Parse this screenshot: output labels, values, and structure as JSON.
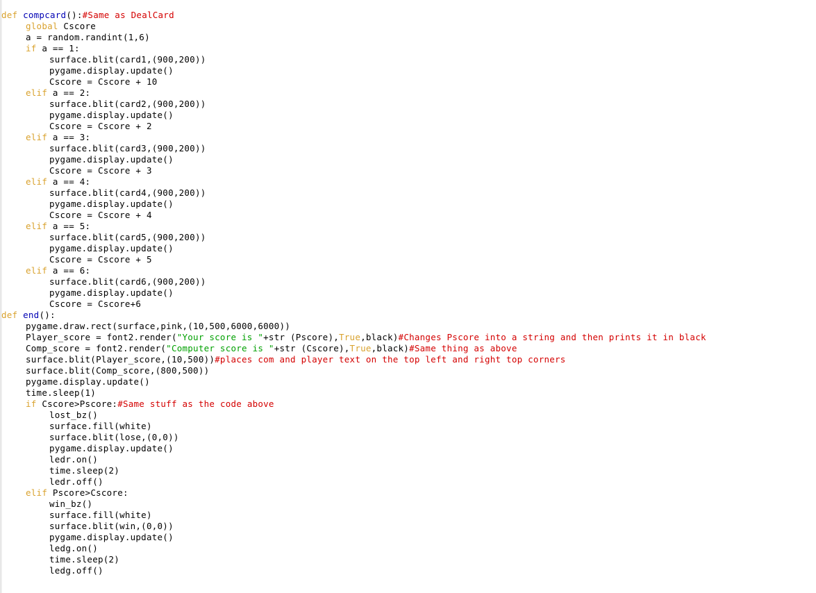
{
  "document": {
    "kind": "source-code-listing",
    "language": "Python",
    "font": "monospace",
    "background_color": "#ffffff"
  },
  "theme": {
    "keyword_color": "#d9a22e",
    "function_name_color": "#0000b4",
    "string_color": "#00a000",
    "comment_color": "#d40000",
    "default_text_color": "#000000",
    "background_color": "#ffffff",
    "border_color": "#e8e8e8"
  },
  "code": {
    "lines": [
      {
        "id": 1,
        "indent": 0,
        "tokens": [
          {
            "t": "def",
            "c": "kw"
          },
          {
            "t": " ",
            "c": "plain"
          },
          {
            "t": "compcard",
            "c": "fn"
          },
          {
            "t": "():",
            "c": "plain"
          },
          {
            "t": "#Same as DealCard",
            "c": "com"
          }
        ]
      },
      {
        "id": 2,
        "indent": 1,
        "tokens": [
          {
            "t": "global",
            "c": "kw"
          },
          {
            "t": " Cscore",
            "c": "plain"
          }
        ]
      },
      {
        "id": 3,
        "indent": 1,
        "tokens": [
          {
            "t": "a = random.randint(1,6)",
            "c": "plain"
          }
        ]
      },
      {
        "id": 4,
        "indent": 1,
        "tokens": [
          {
            "t": "if",
            "c": "kw"
          },
          {
            "t": " a == 1:",
            "c": "plain"
          }
        ]
      },
      {
        "id": 5,
        "indent": 2,
        "tokens": [
          {
            "t": "surface.blit(card1,(900,200))",
            "c": "plain"
          }
        ]
      },
      {
        "id": 6,
        "indent": 2,
        "tokens": [
          {
            "t": "pygame.display.update()",
            "c": "plain"
          }
        ]
      },
      {
        "id": 7,
        "indent": 2,
        "tokens": [
          {
            "t": "Cscore = Cscore + 10",
            "c": "plain"
          }
        ]
      },
      {
        "id": 8,
        "indent": 1,
        "tokens": [
          {
            "t": "elif",
            "c": "kw"
          },
          {
            "t": " a == 2:",
            "c": "plain"
          }
        ]
      },
      {
        "id": 9,
        "indent": 2,
        "tokens": [
          {
            "t": "surface.blit(card2,(900,200))",
            "c": "plain"
          }
        ]
      },
      {
        "id": 10,
        "indent": 2,
        "tokens": [
          {
            "t": "pygame.display.update()",
            "c": "plain"
          }
        ]
      },
      {
        "id": 11,
        "indent": 2,
        "tokens": [
          {
            "t": "Cscore = Cscore + 2",
            "c": "plain"
          }
        ]
      },
      {
        "id": 12,
        "indent": 1,
        "tokens": [
          {
            "t": "elif",
            "c": "kw"
          },
          {
            "t": " a == 3:",
            "c": "plain"
          }
        ]
      },
      {
        "id": 13,
        "indent": 2,
        "tokens": [
          {
            "t": "surface.blit(card3,(900,200))",
            "c": "plain"
          }
        ]
      },
      {
        "id": 14,
        "indent": 2,
        "tokens": [
          {
            "t": "pygame.display.update()",
            "c": "plain"
          }
        ]
      },
      {
        "id": 15,
        "indent": 2,
        "tokens": [
          {
            "t": "Cscore = Cscore + 3",
            "c": "plain"
          }
        ]
      },
      {
        "id": 16,
        "indent": 1,
        "tokens": [
          {
            "t": "elif",
            "c": "kw"
          },
          {
            "t": " a == 4:",
            "c": "plain"
          }
        ]
      },
      {
        "id": 17,
        "indent": 2,
        "tokens": [
          {
            "t": "surface.blit(card4,(900,200))",
            "c": "plain"
          }
        ]
      },
      {
        "id": 18,
        "indent": 2,
        "tokens": [
          {
            "t": "pygame.display.update()",
            "c": "plain"
          }
        ]
      },
      {
        "id": 19,
        "indent": 2,
        "tokens": [
          {
            "t": "Cscore = Cscore + 4",
            "c": "plain"
          }
        ]
      },
      {
        "id": 20,
        "indent": 1,
        "tokens": [
          {
            "t": "elif",
            "c": "kw"
          },
          {
            "t": " a == 5:",
            "c": "plain"
          }
        ]
      },
      {
        "id": 21,
        "indent": 2,
        "tokens": [
          {
            "t": "surface.blit(card5,(900,200))",
            "c": "plain"
          }
        ]
      },
      {
        "id": 22,
        "indent": 2,
        "tokens": [
          {
            "t": "pygame.display.update()",
            "c": "plain"
          }
        ]
      },
      {
        "id": 23,
        "indent": 2,
        "tokens": [
          {
            "t": "Cscore = Cscore + 5",
            "c": "plain"
          }
        ]
      },
      {
        "id": 24,
        "indent": 1,
        "tokens": [
          {
            "t": "elif",
            "c": "kw"
          },
          {
            "t": " a == 6:",
            "c": "plain"
          }
        ]
      },
      {
        "id": 25,
        "indent": 2,
        "tokens": [
          {
            "t": "surface.blit(card6,(900,200))",
            "c": "plain"
          }
        ]
      },
      {
        "id": 26,
        "indent": 2,
        "tokens": [
          {
            "t": "pygame.display.update()",
            "c": "plain"
          }
        ]
      },
      {
        "id": 27,
        "indent": 2,
        "tokens": [
          {
            "t": "Cscore = Cscore+6",
            "c": "plain"
          }
        ]
      },
      {
        "id": 28,
        "indent": 0,
        "tokens": [
          {
            "t": "def",
            "c": "kw"
          },
          {
            "t": " ",
            "c": "plain"
          },
          {
            "t": "end",
            "c": "fn"
          },
          {
            "t": "():",
            "c": "plain"
          }
        ]
      },
      {
        "id": 29,
        "indent": 1,
        "tokens": [
          {
            "t": "pygame.draw.rect(surface,pink,(10,500,6000,6000))",
            "c": "plain"
          }
        ]
      },
      {
        "id": 30,
        "indent": 1,
        "tokens": [
          {
            "t": "Player_score = font2.render(",
            "c": "plain"
          },
          {
            "t": "\"Your score is \"",
            "c": "str"
          },
          {
            "t": "+str (Pscore),",
            "c": "plain"
          },
          {
            "t": "True",
            "c": "kw"
          },
          {
            "t": ",black)",
            "c": "plain"
          },
          {
            "t": "#Changes Pscore into a string and then prints it in black",
            "c": "com"
          }
        ]
      },
      {
        "id": 31,
        "indent": 1,
        "tokens": [
          {
            "t": "Comp_score = font2.render(",
            "c": "plain"
          },
          {
            "t": "\"Computer score is \"",
            "c": "str"
          },
          {
            "t": "+str (Cscore),",
            "c": "plain"
          },
          {
            "t": "True",
            "c": "kw"
          },
          {
            "t": ",black)",
            "c": "plain"
          },
          {
            "t": "#Same thing as above",
            "c": "com"
          }
        ]
      },
      {
        "id": 32,
        "indent": 1,
        "tokens": [
          {
            "t": "surface.blit(Player_score,(10,500))",
            "c": "plain"
          },
          {
            "t": "#places com and player text on the top left and right top corners",
            "c": "com"
          }
        ]
      },
      {
        "id": 33,
        "indent": 1,
        "tokens": [
          {
            "t": "surface.blit(Comp_score,(800,500))",
            "c": "plain"
          }
        ]
      },
      {
        "id": 34,
        "indent": 1,
        "tokens": [
          {
            "t": "pygame.display.update()",
            "c": "plain"
          }
        ]
      },
      {
        "id": 35,
        "indent": 1,
        "tokens": [
          {
            "t": "time.sleep(1)",
            "c": "plain"
          }
        ]
      },
      {
        "id": 36,
        "indent": 1,
        "tokens": [
          {
            "t": "if",
            "c": "kw"
          },
          {
            "t": " Cscore>Pscore:",
            "c": "plain"
          },
          {
            "t": "#Same stuff as the code above",
            "c": "com"
          }
        ]
      },
      {
        "id": 37,
        "indent": 2,
        "tokens": [
          {
            "t": "lost_bz()",
            "c": "plain"
          }
        ]
      },
      {
        "id": 38,
        "indent": 2,
        "tokens": [
          {
            "t": "surface.fill(white)",
            "c": "plain"
          }
        ]
      },
      {
        "id": 39,
        "indent": 2,
        "tokens": [
          {
            "t": "surface.blit(lose,(0,0))",
            "c": "plain"
          }
        ]
      },
      {
        "id": 40,
        "indent": 2,
        "tokens": [
          {
            "t": "pygame.display.update()",
            "c": "plain"
          }
        ]
      },
      {
        "id": 41,
        "indent": 2,
        "tokens": [
          {
            "t": "ledr.on()",
            "c": "plain"
          }
        ]
      },
      {
        "id": 42,
        "indent": 2,
        "tokens": [
          {
            "t": "time.sleep(2)",
            "c": "plain"
          }
        ]
      },
      {
        "id": 43,
        "indent": 2,
        "tokens": [
          {
            "t": "ledr.off()",
            "c": "plain"
          }
        ]
      },
      {
        "id": 44,
        "indent": 1,
        "tokens": [
          {
            "t": "elif",
            "c": "kw"
          },
          {
            "t": " Pscore>Cscore:",
            "c": "plain"
          }
        ]
      },
      {
        "id": 45,
        "indent": 2,
        "tokens": [
          {
            "t": "win_bz()",
            "c": "plain"
          }
        ]
      },
      {
        "id": 46,
        "indent": 2,
        "tokens": [
          {
            "t": "surface.fill(white)",
            "c": "plain"
          }
        ]
      },
      {
        "id": 47,
        "indent": 2,
        "tokens": [
          {
            "t": "surface.blit(win,(0,0))",
            "c": "plain"
          }
        ]
      },
      {
        "id": 48,
        "indent": 2,
        "tokens": [
          {
            "t": "pygame.display.update()",
            "c": "plain"
          }
        ]
      },
      {
        "id": 49,
        "indent": 2,
        "tokens": [
          {
            "t": "ledg.on()",
            "c": "plain"
          }
        ]
      },
      {
        "id": 50,
        "indent": 2,
        "tokens": [
          {
            "t": "time.sleep(2)",
            "c": "plain"
          }
        ]
      },
      {
        "id": 51,
        "indent": 2,
        "tokens": [
          {
            "t": "ledg.off()",
            "c": "plain"
          }
        ]
      }
    ]
  }
}
